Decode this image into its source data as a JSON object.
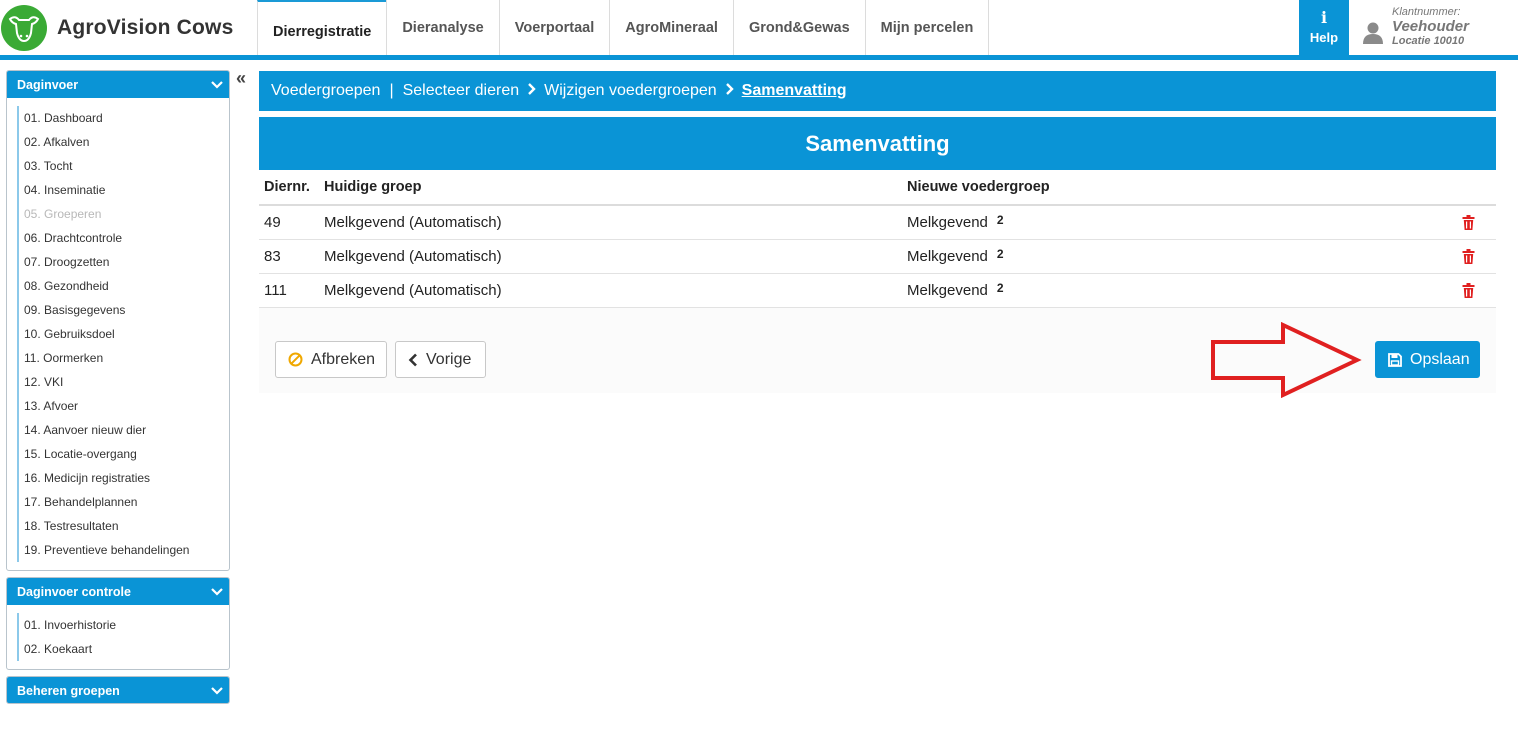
{
  "app": {
    "title": "AgroVision Cows"
  },
  "nav": {
    "tabs": [
      {
        "label": "Dierregistratie",
        "active": true
      },
      {
        "label": "Dieranalyse"
      },
      {
        "label": "Voerportaal"
      },
      {
        "label": "AgroMineraal"
      },
      {
        "label": "Grond&Gewas"
      },
      {
        "label": "Mijn percelen"
      }
    ],
    "help_label": "Help",
    "user": {
      "customer_label": "Klantnummer:",
      "name": "Veehouder",
      "location": "Locatie 10010"
    }
  },
  "sidebar": {
    "panels": [
      {
        "title": "Daginvoer",
        "items": [
          "01. Dashboard",
          "02. Afkalven",
          "03. Tocht",
          "04. Inseminatie",
          "05. Groeperen",
          "06. Drachtcontrole",
          "07. Droogzetten",
          "08. Gezondheid",
          "09. Basisgegevens",
          "10. Gebruiksdoel",
          "11. Oormerken",
          "12. VKI",
          "13. Afvoer",
          "14. Aanvoer nieuw dier",
          "15. Locatie-overgang",
          "16. Medicijn registraties",
          "17. Behandelplannen",
          "18. Testresultaten",
          "19. Preventieve behandelingen"
        ]
      },
      {
        "title": "Daginvoer controle",
        "items": [
          "01. Invoerhistorie",
          "02. Koekaart"
        ]
      },
      {
        "title": "Beheren groepen",
        "items": []
      }
    ],
    "collapse_icon": "«"
  },
  "breadcrumb": {
    "step1": "Voedergroepen",
    "sep": "|",
    "step2": "Selecteer dieren",
    "step3": "Wijzigen voedergroepen",
    "current": "Samenvatting"
  },
  "summary": {
    "title": "Samenvatting",
    "columns": [
      "Diernr.",
      "Huidige groep",
      "Nieuwe voedergroep"
    ],
    "rows": [
      {
        "diernr": "49",
        "current": "Melkgevend (Automatisch)",
        "new": "Melkgevend",
        "new_num": "2"
      },
      {
        "diernr": "83",
        "current": "Melkgevend (Automatisch)",
        "new": "Melkgevend",
        "new_num": "2"
      },
      {
        "diernr": "111",
        "current": "Melkgevend (Automatisch)",
        "new": "Melkgevend",
        "new_num": "2"
      }
    ]
  },
  "buttons": {
    "abort": "Afbreken",
    "previous": "Vorige",
    "save": "Opslaan"
  },
  "colors": {
    "accent": "#0a94d6",
    "brand_green": "#3aaa35",
    "danger": "#e02020",
    "abort_icon": "#f0a800"
  }
}
